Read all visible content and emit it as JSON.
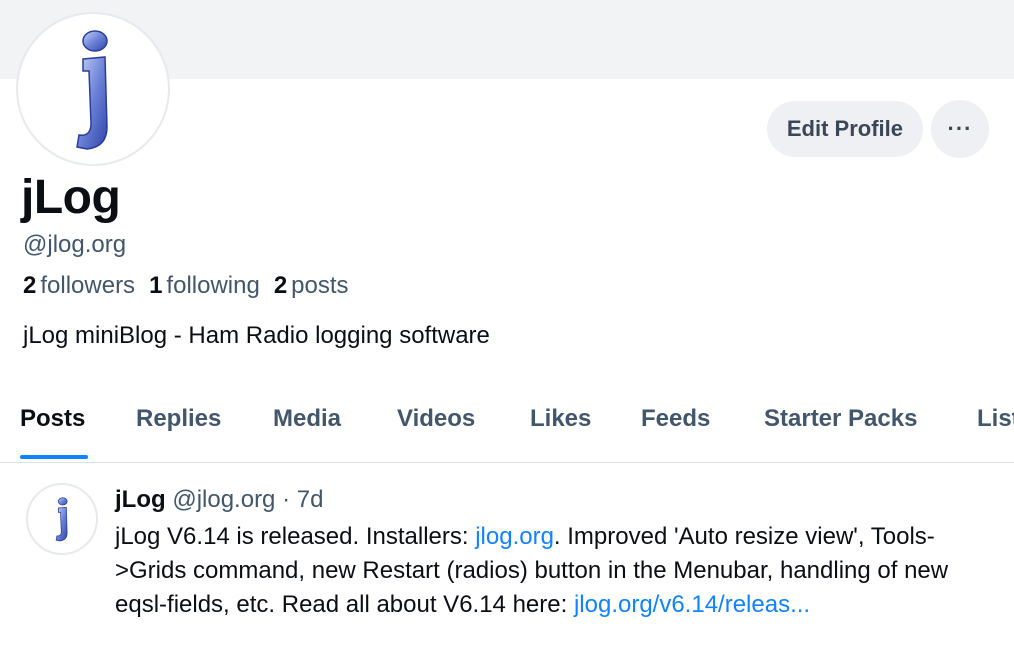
{
  "profile": {
    "name": "jLog",
    "handle": "@jlog.org",
    "followers_count": "2",
    "followers_label": "followers",
    "following_count": "1",
    "following_label": "following",
    "posts_count": "2",
    "posts_label": "posts",
    "bio": "jLog miniBlog - Ham Radio logging software",
    "avatar_letter": "j"
  },
  "actions": {
    "edit_label": "Edit Profile",
    "more_label": "···"
  },
  "tabs": [
    {
      "label": "Posts",
      "active": true
    },
    {
      "label": "Replies"
    },
    {
      "label": "Media"
    },
    {
      "label": "Videos"
    },
    {
      "label": "Likes"
    },
    {
      "label": "Feeds"
    },
    {
      "label": "Starter Packs"
    },
    {
      "label": "Lists"
    }
  ],
  "post": {
    "author": "jLog",
    "handle": "@jlog.org",
    "sep": "·",
    "time": "7d",
    "text_1": "jLog V6.14 is released. Installers: ",
    "link_1": "jlog.org",
    "text_2": ". Improved 'Auto resize view', Tools->Grids command, new Restart (radios) button in the Menubar, handling of new eqsl-fields, etc. Read all about V6.14 here: ",
    "link_2": "jlog.org/v6.14/releas..."
  },
  "colors": {
    "accent": "#1083fe",
    "muted_text": "#42576c",
    "banner": "#f1f3f5",
    "button_bg": "#eef0f3"
  }
}
